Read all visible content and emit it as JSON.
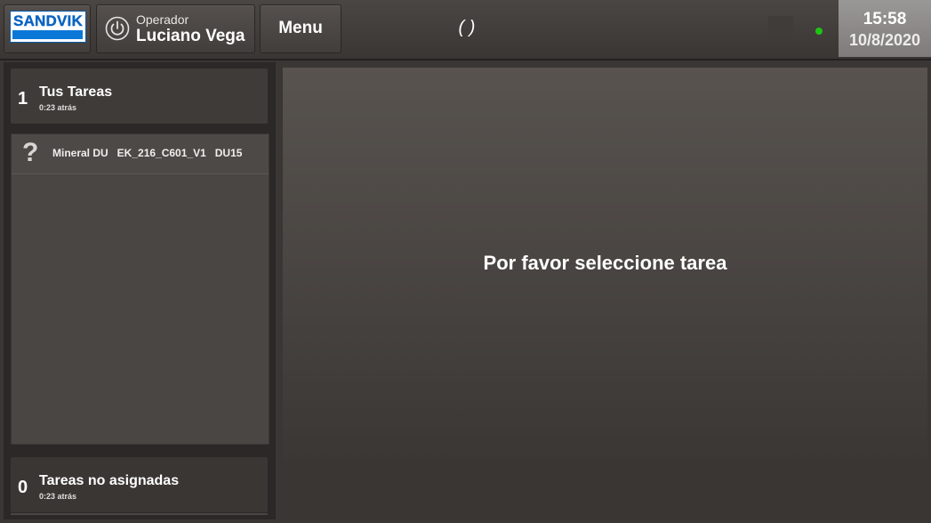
{
  "logo": {
    "text": "SANDVIK"
  },
  "operator": {
    "label": "Operador",
    "name": "Luciano Vega"
  },
  "menu": {
    "label": "Menu"
  },
  "status": {
    "placeholder": "( )",
    "indicator_color": "#1ec414"
  },
  "clock": {
    "time": "15:58",
    "date": "10/8/2020"
  },
  "your_tasks": {
    "count": "1",
    "title": "Tus Tareas",
    "time": "0:23 atrás"
  },
  "task_list": [
    {
      "icon": "question-mark-icon",
      "text": "Mineral DU   EK_216_C601_V1   DU15"
    }
  ],
  "unassigned": {
    "count": "0",
    "title": "Tareas no asignadas",
    "time": "0:23 atrás"
  },
  "main": {
    "message": "Por favor seleccione tarea"
  }
}
